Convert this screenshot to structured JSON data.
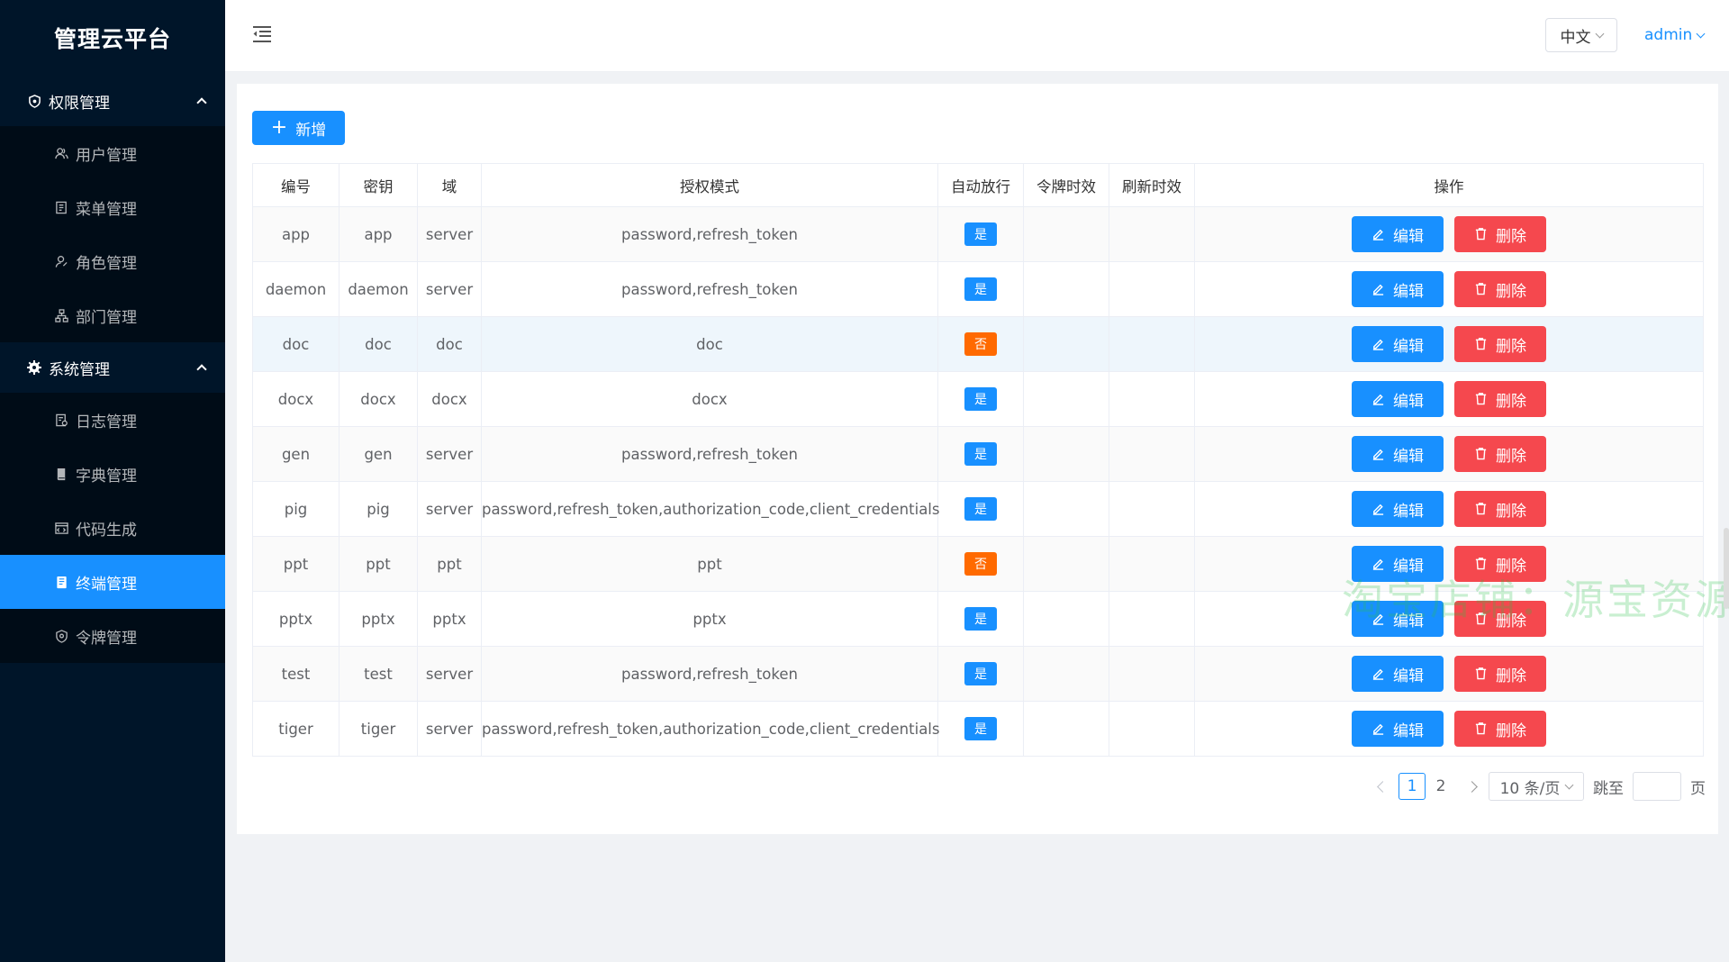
{
  "app": {
    "title": "管理云平台"
  },
  "sidebar": {
    "groups": [
      {
        "label": "权限管理",
        "items": [
          {
            "label": "用户管理",
            "icon": "user-icon"
          },
          {
            "label": "菜单管理",
            "icon": "menu-icon"
          },
          {
            "label": "角色管理",
            "icon": "role-icon"
          },
          {
            "label": "部门管理",
            "icon": "dept-icon"
          }
        ]
      },
      {
        "label": "系统管理",
        "items": [
          {
            "label": "日志管理",
            "icon": "log-icon"
          },
          {
            "label": "字典管理",
            "icon": "dict-icon"
          },
          {
            "label": "代码生成",
            "icon": "code-icon"
          },
          {
            "label": "终端管理",
            "icon": "terminal-icon",
            "active": true
          },
          {
            "label": "令牌管理",
            "icon": "token-icon"
          }
        ]
      }
    ]
  },
  "header": {
    "language": "中文",
    "user": "admin"
  },
  "toolbar": {
    "add_label": "新增"
  },
  "table": {
    "columns": [
      "编号",
      "密钥",
      "域",
      "授权模式",
      "自动放行",
      "令牌时效",
      "刷新时效",
      "操作"
    ],
    "rows": [
      {
        "id": "app",
        "secret": "app",
        "scope": "server",
        "grant": "password,refresh_token",
        "auto": "是",
        "token_ttl": "",
        "refresh_ttl": ""
      },
      {
        "id": "daemon",
        "secret": "daemon",
        "scope": "server",
        "grant": "password,refresh_token",
        "auto": "是",
        "token_ttl": "",
        "refresh_ttl": ""
      },
      {
        "id": "doc",
        "secret": "doc",
        "scope": "doc",
        "grant": "doc",
        "auto": "否",
        "token_ttl": "",
        "refresh_ttl": ""
      },
      {
        "id": "docx",
        "secret": "docx",
        "scope": "docx",
        "grant": "docx",
        "auto": "是",
        "token_ttl": "",
        "refresh_ttl": ""
      },
      {
        "id": "gen",
        "secret": "gen",
        "scope": "server",
        "grant": "password,refresh_token",
        "auto": "是",
        "token_ttl": "",
        "refresh_ttl": ""
      },
      {
        "id": "pig",
        "secret": "pig",
        "scope": "server",
        "grant": "password,refresh_token,authorization_code,client_credentials",
        "auto": "是",
        "token_ttl": "",
        "refresh_ttl": ""
      },
      {
        "id": "ppt",
        "secret": "ppt",
        "scope": "ppt",
        "grant": "ppt",
        "auto": "否",
        "token_ttl": "",
        "refresh_ttl": ""
      },
      {
        "id": "pptx",
        "secret": "pptx",
        "scope": "pptx",
        "grant": "pptx",
        "auto": "是",
        "token_ttl": "",
        "refresh_ttl": ""
      },
      {
        "id": "test",
        "secret": "test",
        "scope": "server",
        "grant": "password,refresh_token",
        "auto": "是",
        "token_ttl": "",
        "refresh_ttl": ""
      },
      {
        "id": "tiger",
        "secret": "tiger",
        "scope": "server",
        "grant": "password,refresh_token,authorization_code,client_credentials",
        "auto": "是",
        "token_ttl": "",
        "refresh_ttl": ""
      }
    ],
    "edit_label": "编辑",
    "delete_label": "删除"
  },
  "pagination": {
    "pages": [
      "1",
      "2"
    ],
    "current": "1",
    "page_size": "10 条/页",
    "jump_label": "跳至",
    "page_suffix": "页"
  },
  "watermark": "淘宝店铺：源宝资源",
  "colors": {
    "sidebar_bg": "#001529",
    "primary": "#1890ff",
    "danger": "#f5484e",
    "warning": "#ff6a00"
  }
}
